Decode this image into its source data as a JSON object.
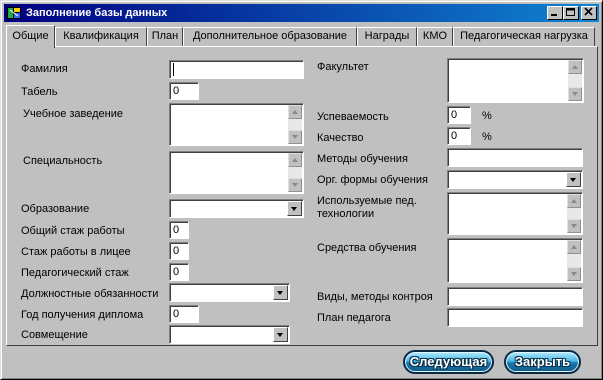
{
  "window": {
    "title": "Заполнение базы данных"
  },
  "tabs": [
    "Общие",
    "Квалификация",
    "План",
    "Дополнительное образование",
    "Награды",
    "КМО",
    "Педагогическая нагрузка"
  ],
  "left": {
    "familiya": {
      "label": "Фамилия",
      "value": ""
    },
    "tabel": {
      "label": "Табель",
      "value": "0"
    },
    "uchebnoe": {
      "label": "Учебное заведение",
      "value": ""
    },
    "specialnost": {
      "label": "Специальность",
      "value": ""
    },
    "obrazovanie": {
      "label": "Образование",
      "value": ""
    },
    "stazh_obshiy": {
      "label": "Общий стаж работы",
      "value": "0"
    },
    "stazh_licey": {
      "label": "Стаж работы в лицее",
      "value": "0"
    },
    "stazh_ped": {
      "label": "Педагогический стаж",
      "value": "0"
    },
    "dolzhnost": {
      "label": "Должностные обязанности",
      "value": ""
    },
    "god_diploma": {
      "label": "Год получения диплома",
      "value": "0"
    },
    "sovmeshenie": {
      "label": "Совмещение",
      "value": ""
    }
  },
  "right": {
    "fakultet": {
      "label": "Факультет",
      "value": ""
    },
    "uspevaemost": {
      "label": "Успеваемость",
      "value": "0",
      "unit": "%"
    },
    "kachestvo": {
      "label": "Качество",
      "value": "0",
      "unit": "%"
    },
    "metody": {
      "label": "Методы обучения",
      "value": ""
    },
    "org_formy": {
      "label": "Орг. формы обучения",
      "value": ""
    },
    "ped_tech": {
      "label": "Используемые пед. технологии",
      "value": ""
    },
    "sredstva": {
      "label": "Средства обучения",
      "value": ""
    },
    "vidy_kontrol": {
      "label": "Виды, методы контроя",
      "value": ""
    },
    "plan_pedagoga": {
      "label": "План педагога",
      "value": ""
    }
  },
  "buttons": {
    "next": "Следующая",
    "close": "Закрыть"
  },
  "icons": {
    "minimize": "minimize-icon",
    "maximize": "maximize-icon",
    "close": "close-icon",
    "app": "app-icon"
  },
  "colors": {
    "titlebar": "#000080",
    "face": "#c0c0c0",
    "button": "#1877ad"
  }
}
